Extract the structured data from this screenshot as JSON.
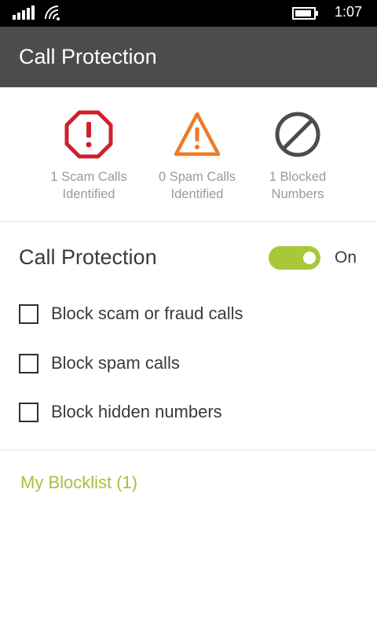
{
  "status_bar": {
    "time": "1:07",
    "icons": [
      "signal-icon",
      "wifi-icon",
      "battery-icon"
    ]
  },
  "header": {
    "title": "Call Protection"
  },
  "stats": [
    {
      "line1": "1 Scam Calls",
      "line2": "Identified",
      "icon": "octagon-alert-icon",
      "color": "#d0202e"
    },
    {
      "line1": "0 Spam Calls",
      "line2": "Identified",
      "icon": "triangle-warning-icon",
      "color": "#ee7a24"
    },
    {
      "line1": "1 Blocked",
      "line2": "Numbers",
      "icon": "blocked-icon",
      "color": "#4c4c4c"
    }
  ],
  "protection": {
    "title": "Call Protection",
    "toggle_state": "On",
    "toggle_color": "#a8c83a",
    "options": [
      {
        "label": "Block scam or fraud calls",
        "checked": false
      },
      {
        "label": "Block spam calls",
        "checked": false
      },
      {
        "label": "Block hidden numbers",
        "checked": false
      }
    ]
  },
  "blocklist": {
    "label": "My Blocklist (1)",
    "color": "#a6c13d"
  }
}
